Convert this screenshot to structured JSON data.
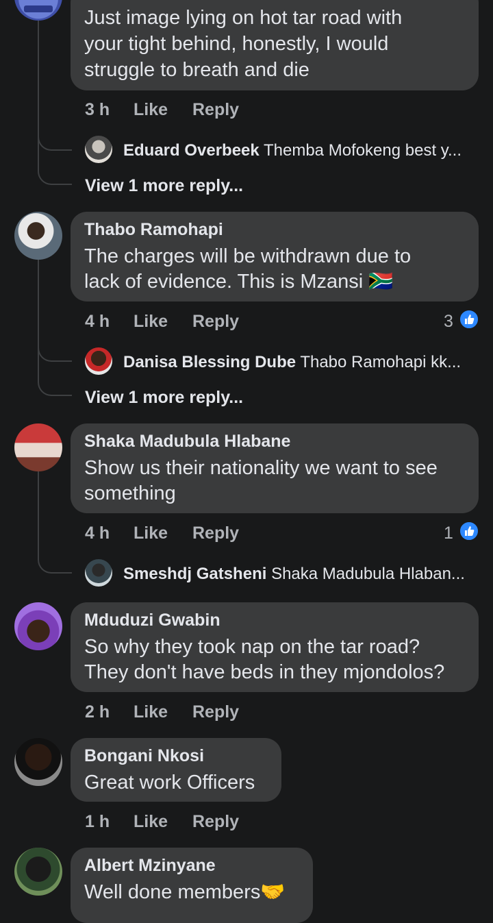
{
  "c1": {
    "text": [
      "Just image lying on hot tar road with",
      "your tight behind, honestly, I would",
      "struggle to breath and die"
    ],
    "time": "3 h",
    "like": "Like",
    "reply": "Reply",
    "sub_reply": {
      "author": "Eduard Overbeek",
      "text": "Themba Mofokeng best y..."
    },
    "more": "View 1 more reply..."
  },
  "c2": {
    "author": "Thabo Ramohapi",
    "text": [
      "The charges will be withdrawn due to",
      "lack of evidence. This is Mzansi"
    ],
    "flag": "🇿🇦",
    "time": "4 h",
    "like": "Like",
    "reply": "Reply",
    "reactions": "3",
    "sub_reply": {
      "author": "Danisa Blessing Dube",
      "text": "Thabo Ramohapi kk..."
    },
    "more": "View 1 more reply..."
  },
  "c3": {
    "author": "Shaka Madubula Hlabane",
    "text": [
      "Show us their nationality we want to see",
      "something"
    ],
    "time": "4 h",
    "like": "Like",
    "reply": "Reply",
    "reactions": "1",
    "sub_reply": {
      "author": "Smeshdj Gatsheni",
      "text": "Shaka Madubula Hlaban..."
    }
  },
  "c4": {
    "author": "Mduduzi Gwabin",
    "text": [
      "So why they took nap on the tar road?",
      "They don't have beds in they mjondolos?"
    ],
    "time": "2 h",
    "like": "Like",
    "reply": "Reply"
  },
  "c5": {
    "author": "Bongani Nkosi",
    "text": [
      "Great work Officers"
    ],
    "time": "1 h",
    "like": "Like",
    "reply": "Reply"
  },
  "c6": {
    "author": "Albert Mzinyane",
    "text": [
      "Well done members"
    ],
    "emoji": "🤝"
  },
  "icons": {
    "like_badge": "thumbs-up-icon"
  },
  "colors": {
    "background": "#18191a",
    "bubble": "#3a3b3c",
    "accent": "#2d88ff"
  }
}
